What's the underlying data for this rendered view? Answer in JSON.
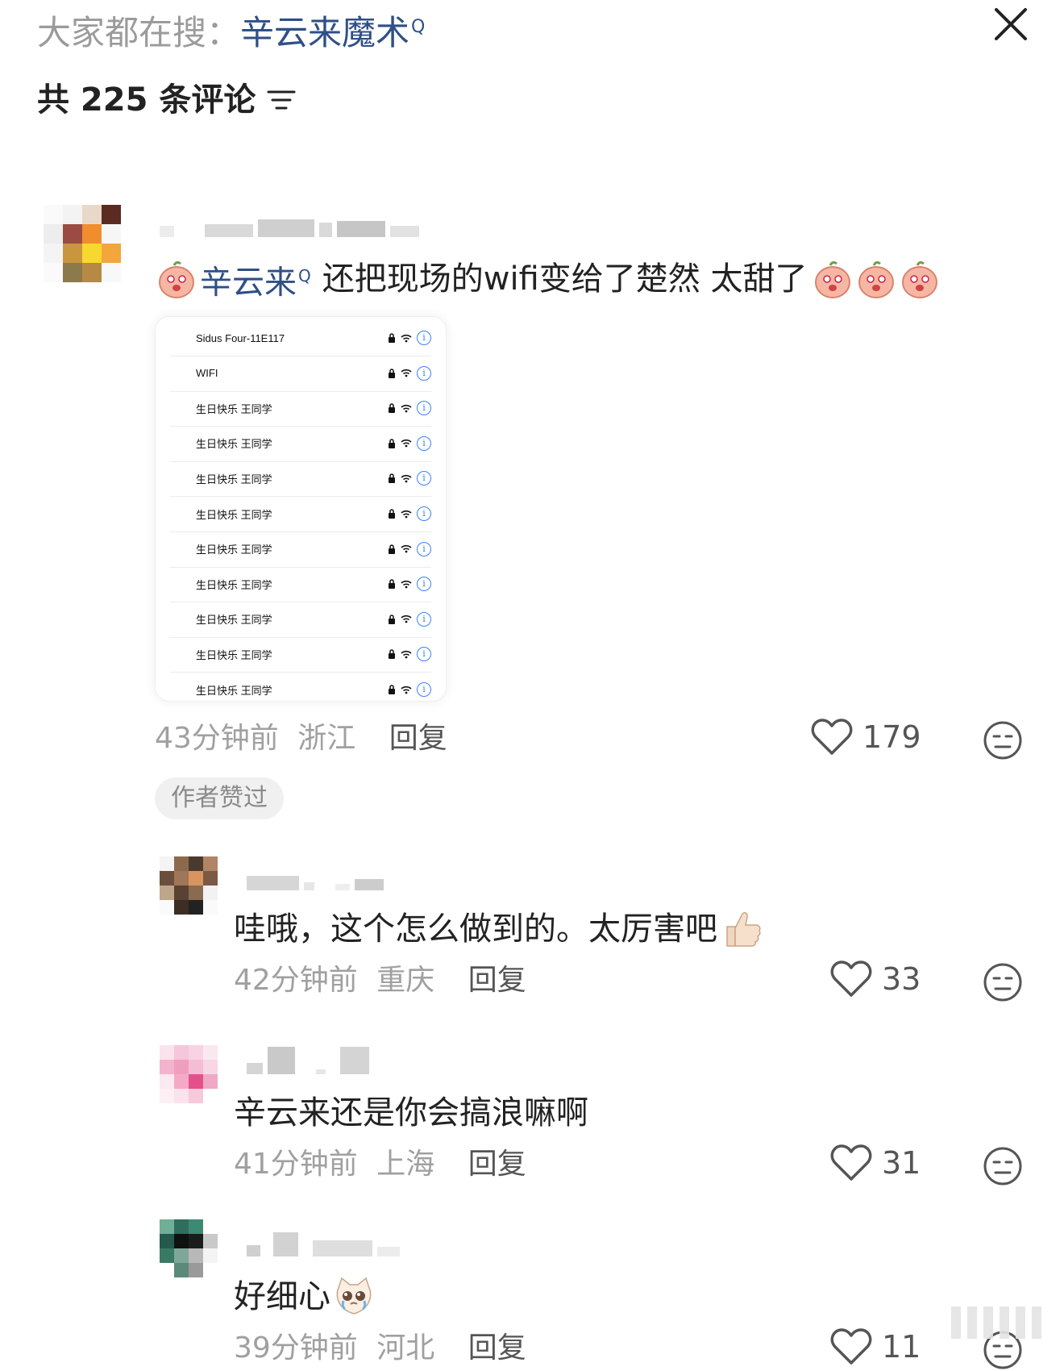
{
  "header": {
    "search_prefix": "大家都在搜：",
    "search_keyword": "辛云来魔术",
    "search_glyph": "Q",
    "comment_count_label": "共 225 条评论"
  },
  "comments": [
    {
      "mention": "辛云来",
      "mention_glyph": "Q",
      "text": "还把现场的wifi变给了楚然 太甜了",
      "wifi_list": [
        "Sidus Four-11E117",
        "WIFI",
        "生日快乐 王同学",
        "生日快乐 王同学",
        "生日快乐 王同学",
        "生日快乐 王同学",
        "生日快乐 王同学",
        "生日快乐 王同学",
        "生日快乐 王同学",
        "生日快乐 王同学",
        "生日快乐 王同学"
      ],
      "wifi_info_glyph": "i",
      "time": "43分钟前",
      "location": "浙江",
      "reply_label": "回复",
      "likes": "179",
      "badge": "作者赞过"
    },
    {
      "text": "哇哦，这个怎么做到的。太厉害吧",
      "time": "42分钟前",
      "location": "重庆",
      "reply_label": "回复",
      "likes": "33"
    },
    {
      "text": "辛云来还是你会搞浪嘛啊",
      "time": "41分钟前",
      "location": "上海",
      "reply_label": "回复",
      "likes": "31"
    },
    {
      "text": "好细心",
      "time": "39分钟前",
      "location": "河北",
      "reply_label": "回复",
      "likes": "11"
    }
  ],
  "colors": {
    "mention_blue": "#2f4f86",
    "meta_gray": "#a0a0a0",
    "info_blue": "#3b82f6"
  },
  "icons": {
    "close": "close-icon",
    "sort": "sort-filter-icon",
    "like": "heart-outline-icon",
    "more": "neutral-face-icon"
  }
}
